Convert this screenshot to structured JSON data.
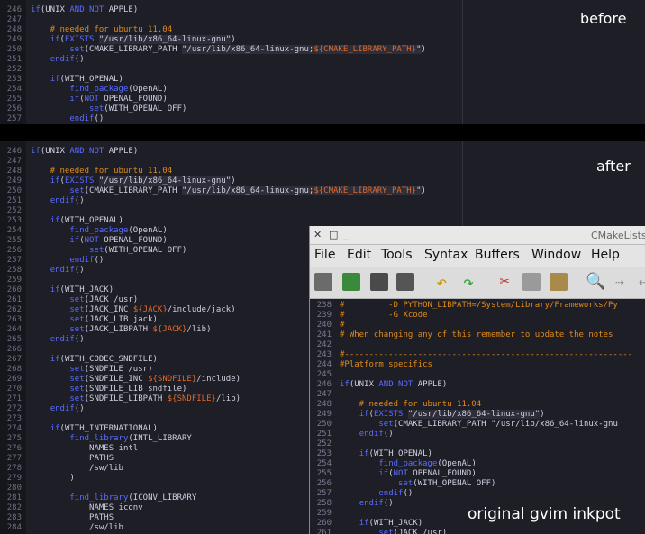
{
  "labels": {
    "before": "before",
    "after": "after",
    "original": "original gvim inkpot"
  },
  "colors": {
    "background": "#1e1e27",
    "keyword": "#5a6bff",
    "comment": "#e08a1a",
    "variable": "#e06a2a",
    "string_bg": "#2e2e3a"
  },
  "before_lines": [
    {
      "n": "246",
      "t": "if(UNIX AND NOT APPLE)"
    },
    {
      "n": "247",
      "t": ""
    },
    {
      "n": "248",
      "t": "    # needed for ubuntu 11.04"
    },
    {
      "n": "249",
      "t": "    if(EXISTS \"/usr/lib/x86_64-linux-gnu\")"
    },
    {
      "n": "250",
      "t": "        set(CMAKE_LIBRARY_PATH \"/usr/lib/x86_64-linux-gnu;${CMAKE_LIBRARY_PATH}\")"
    },
    {
      "n": "251",
      "t": "    endif()"
    },
    {
      "n": "252",
      "t": ""
    },
    {
      "n": "253",
      "t": "    if(WITH_OPENAL)"
    },
    {
      "n": "254",
      "t": "        find_package(OpenAL)"
    },
    {
      "n": "255",
      "t": "        if(NOT OPENAL_FOUND)"
    },
    {
      "n": "256",
      "t": "            set(WITH_OPENAL OFF)"
    },
    {
      "n": "257",
      "t": "        endif()"
    }
  ],
  "after_lines": [
    {
      "n": "246",
      "t": "if(UNIX AND NOT APPLE)"
    },
    {
      "n": "247",
      "t": ""
    },
    {
      "n": "248",
      "t": "    # needed for ubuntu 11.04"
    },
    {
      "n": "249",
      "t": "    if(EXISTS \"/usr/lib/x86_64-linux-gnu\")"
    },
    {
      "n": "250",
      "t": "        set(CMAKE_LIBRARY_PATH \"/usr/lib/x86_64-linux-gnu;${CMAKE_LIBRARY_PATH}\")"
    },
    {
      "n": "251",
      "t": "    endif()"
    },
    {
      "n": "252",
      "t": ""
    },
    {
      "n": "253",
      "t": "    if(WITH_OPENAL)"
    },
    {
      "n": "254",
      "t": "        find_package(OpenAL)"
    },
    {
      "n": "255",
      "t": "        if(NOT OPENAL_FOUND)"
    },
    {
      "n": "256",
      "t": "            set(WITH_OPENAL OFF)"
    },
    {
      "n": "257",
      "t": "        endif()"
    },
    {
      "n": "258",
      "t": "    endif()"
    },
    {
      "n": "259",
      "t": ""
    },
    {
      "n": "260",
      "t": "    if(WITH_JACK)"
    },
    {
      "n": "261",
      "t": "        set(JACK /usr)"
    },
    {
      "n": "262",
      "t": "        set(JACK_INC ${JACK}/include/jack)"
    },
    {
      "n": "263",
      "t": "        set(JACK_LIB jack)"
    },
    {
      "n": "264",
      "t": "        set(JACK_LIBPATH ${JACK}/lib)"
    },
    {
      "n": "265",
      "t": "    endif()"
    },
    {
      "n": "266",
      "t": ""
    },
    {
      "n": "267",
      "t": "    if(WITH_CODEC_SNDFILE)"
    },
    {
      "n": "268",
      "t": "        set(SNDFILE /usr)"
    },
    {
      "n": "269",
      "t": "        set(SNDFILE_INC ${SNDFILE}/include)"
    },
    {
      "n": "270",
      "t": "        set(SNDFILE_LIB sndfile)"
    },
    {
      "n": "271",
      "t": "        set(SNDFILE_LIBPATH ${SNDFILE}/lib)"
    },
    {
      "n": "272",
      "t": "    endif()"
    },
    {
      "n": "273",
      "t": ""
    },
    {
      "n": "274",
      "t": "    if(WITH_INTERNATIONAL)"
    },
    {
      "n": "275",
      "t": "        find_library(INTL_LIBRARY"
    },
    {
      "n": "276",
      "t": "            NAMES intl"
    },
    {
      "n": "277",
      "t": "            PATHS"
    },
    {
      "n": "278",
      "t": "            /sw/lib"
    },
    {
      "n": "279",
      "t": "        )"
    },
    {
      "n": "280",
      "t": ""
    },
    {
      "n": "281",
      "t": "        find_library(ICONV_LIBRARY"
    },
    {
      "n": "282",
      "t": "            NAMES iconv"
    },
    {
      "n": "283",
      "t": "            PATHS"
    },
    {
      "n": "284",
      "t": "            /sw/lib"
    }
  ],
  "gvim": {
    "title": "CMakeLists",
    "menu": [
      "File",
      "Edit",
      "Tools",
      "Syntax",
      "Buffers",
      "Window",
      "Help"
    ],
    "toolbar_icons": [
      "open-icon",
      "save-icon",
      "save-all-icon",
      "print-icon",
      "undo-icon",
      "redo-icon",
      "cut-icon",
      "copy-icon",
      "paste-icon",
      "find-icon",
      "next-icon",
      "prev-icon"
    ],
    "lines": [
      {
        "n": "238",
        "t": "#         -D PYTHON_LIBPATH=/System/Library/Frameworks/Py"
      },
      {
        "n": "239",
        "t": "#         -G Xcode"
      },
      {
        "n": "240",
        "t": "#"
      },
      {
        "n": "241",
        "t": "# When changing any of this remember to update the notes"
      },
      {
        "n": "242",
        "t": ""
      },
      {
        "n": "243",
        "t": "#-----------------------------------------------------------"
      },
      {
        "n": "244",
        "t": "#Platform specifics"
      },
      {
        "n": "245",
        "t": ""
      },
      {
        "n": "246",
        "t": "if(UNIX AND NOT APPLE)"
      },
      {
        "n": "247",
        "t": ""
      },
      {
        "n": "248",
        "t": "    # needed for ubuntu 11.04"
      },
      {
        "n": "249",
        "t": "    if(EXISTS \"/usr/lib/x86_64-linux-gnu\")"
      },
      {
        "n": "250",
        "t": "        set(CMAKE_LIBRARY_PATH \"/usr/lib/x86_64-linux-gnu"
      },
      {
        "n": "251",
        "t": "    endif()"
      },
      {
        "n": "252",
        "t": ""
      },
      {
        "n": "253",
        "t": "    if(WITH_OPENAL)"
      },
      {
        "n": "254",
        "t": "        find_package(OpenAL)"
      },
      {
        "n": "255",
        "t": "        if(NOT OPENAL_FOUND)"
      },
      {
        "n": "256",
        "t": "            set(WITH_OPENAL OFF)"
      },
      {
        "n": "257",
        "t": "        endif()"
      },
      {
        "n": "258",
        "t": "    endif()"
      },
      {
        "n": "259",
        "t": ""
      },
      {
        "n": "260",
        "t": "    if(WITH_JACK)"
      },
      {
        "n": "261",
        "t": "        set(JACK /usr)"
      }
    ]
  }
}
